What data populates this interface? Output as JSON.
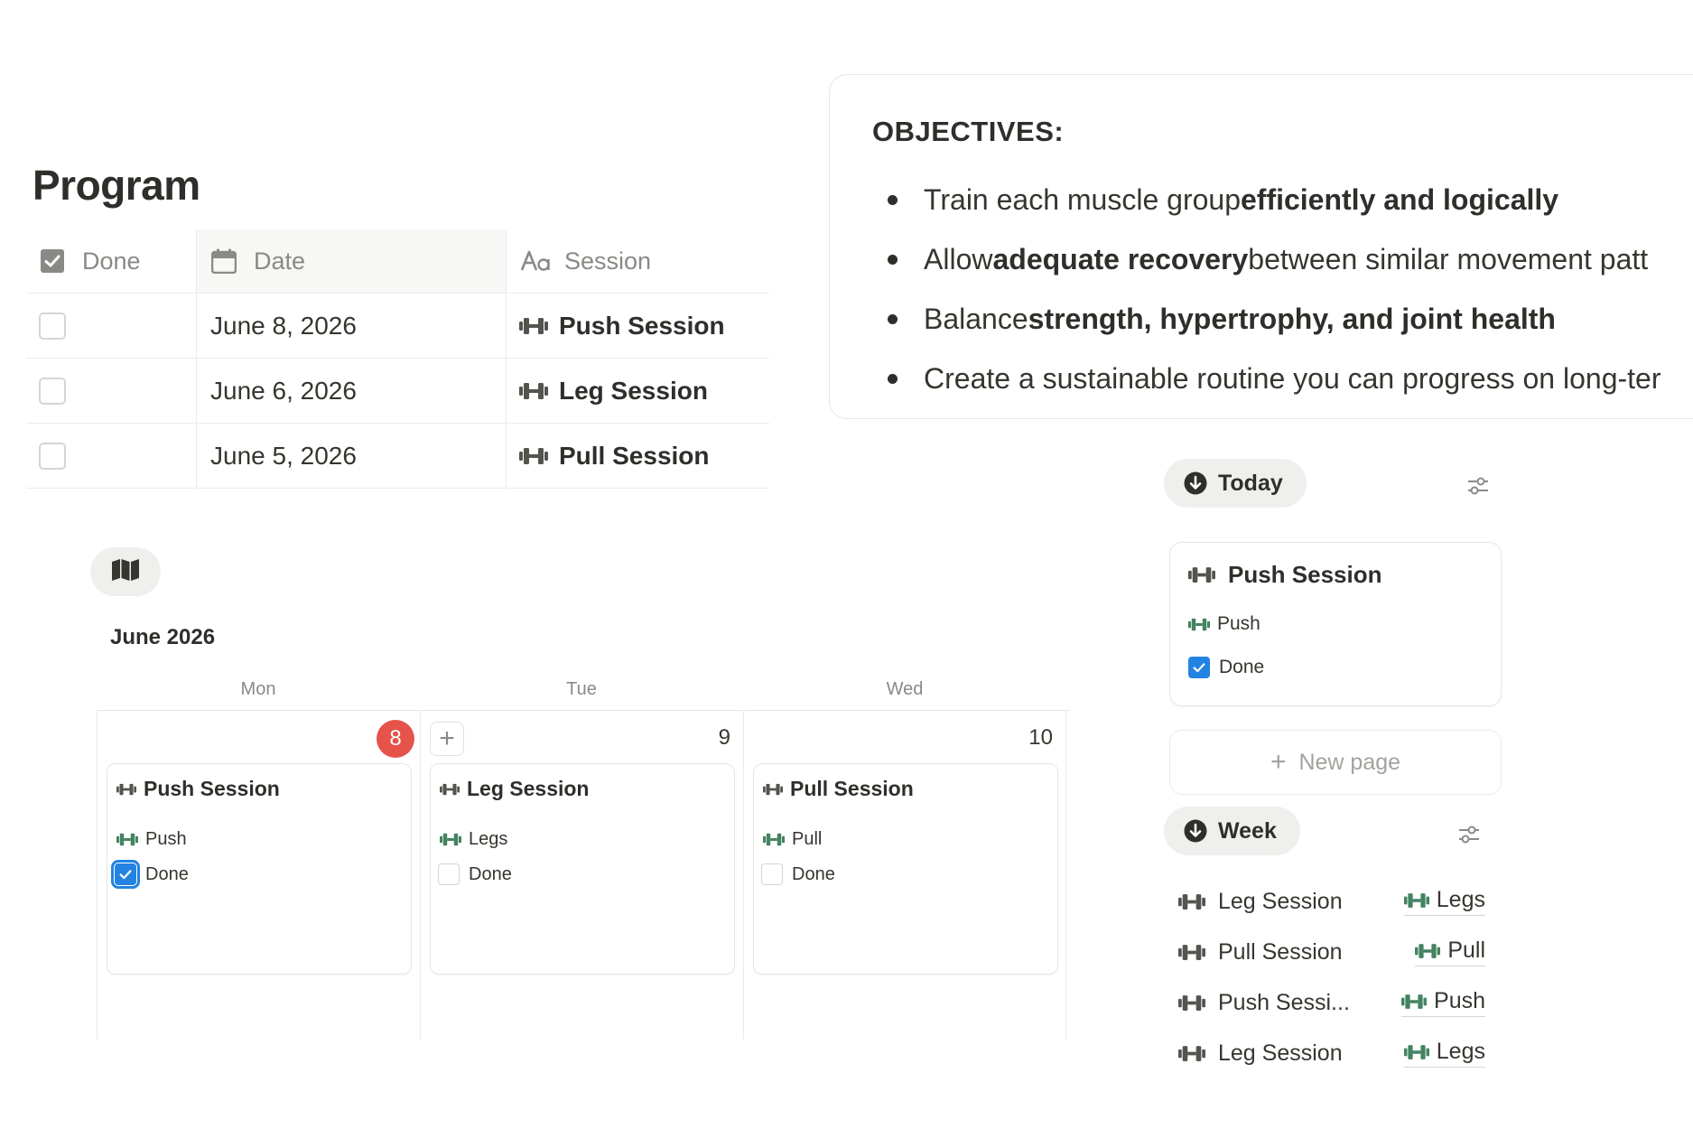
{
  "colors": {
    "accent_blue": "#2383e2",
    "today_red": "#e5534b",
    "tag_green": "#448361",
    "icon_gray": "#55534e"
  },
  "program": {
    "title": "Program",
    "columns": [
      {
        "label": "Done",
        "icon": "checkbox-icon"
      },
      {
        "label": "Date",
        "icon": "calendar-icon"
      },
      {
        "label": "Session",
        "icon": "text-property-icon"
      }
    ],
    "rows": [
      {
        "done": false,
        "date": "June 8, 2026",
        "session": "Push Session",
        "icon": "dumbbell-icon"
      },
      {
        "done": false,
        "date": "June 6, 2026",
        "session": "Leg Session",
        "icon": "dumbbell-icon"
      },
      {
        "done": false,
        "date": "June 5, 2026",
        "session": "Pull Session",
        "icon": "dumbbell-icon"
      }
    ]
  },
  "objectives": {
    "title": "OBJECTIVES:",
    "items": [
      {
        "pre": "Train each muscle group ",
        "bold": "efficiently and logically",
        "post": ""
      },
      {
        "pre": "Allow ",
        "bold": "adequate recovery",
        "post": " between similar movement patt"
      },
      {
        "pre": "Balance ",
        "bold": "strength, hypertrophy, and joint health",
        "post": ""
      },
      {
        "pre": "Create a sustainable routine you can progress on long-ter",
        "bold": "",
        "post": ""
      }
    ]
  },
  "calendar": {
    "view_icon": "map-icon",
    "month": "June 2026",
    "days": [
      {
        "dow": "Mon",
        "num": "8",
        "is_today": true,
        "card": {
          "title": "Push Session",
          "tag": "Push",
          "done_label": "Done",
          "done": true
        }
      },
      {
        "dow": "Tue",
        "num": "9",
        "is_today": false,
        "card": {
          "title": "Leg Session",
          "tag": "Legs",
          "done_label": "Done",
          "done": false
        }
      },
      {
        "dow": "Wed",
        "num": "10",
        "is_today": false,
        "card": {
          "title": "Pull Session",
          "tag": "Pull",
          "done_label": "Done",
          "done": false
        }
      }
    ],
    "add_label": "+"
  },
  "today_view": {
    "label": "Today",
    "card": {
      "title": "Push Session",
      "tag": "Push",
      "done_label": "Done",
      "done": true
    },
    "new_page": "New page"
  },
  "week_view": {
    "label": "Week",
    "rows": [
      {
        "session": "Leg Session",
        "tag": "Legs"
      },
      {
        "session": "Pull Session",
        "tag": "Pull"
      },
      {
        "session": "Push Sessi...",
        "tag": "Push"
      },
      {
        "session": "Leg Session",
        "tag": "Legs"
      }
    ]
  }
}
